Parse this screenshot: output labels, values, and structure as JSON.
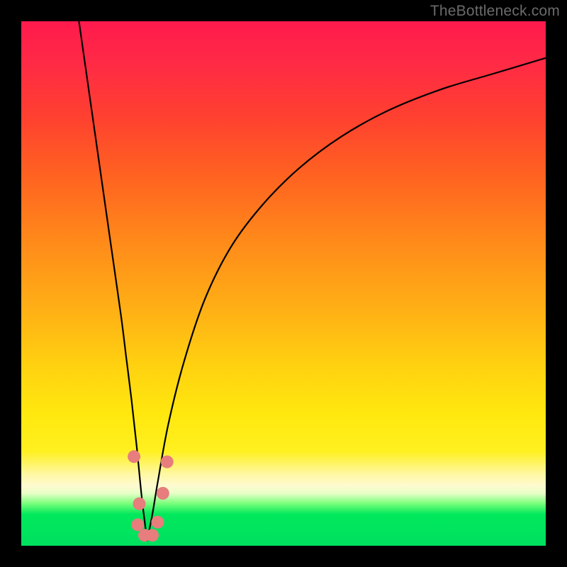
{
  "watermark": "TheBottleneck.com",
  "colors": {
    "frame": "#000000",
    "gradient_top": "#ff1a4d",
    "gradient_mid": "#ffd210",
    "gradient_bottom": "#00e060",
    "curve": "#000000",
    "marker": "#e77d7d"
  },
  "chart_data": {
    "type": "line",
    "title": "",
    "xlabel": "",
    "ylabel": "",
    "xlim": [
      0,
      100
    ],
    "ylim": [
      0,
      100
    ],
    "grid": false,
    "legend": false,
    "note": "Axes are unlabeled in the original image; data values are estimated from pixel positions on a 0–100 scale where 0,0 is the lower-left of the colored plot area. The figure is a V-shaped bottleneck curve: a steep falling branch on the left and a slower rising branch on the right, meeting near x≈24, y≈0. Small pink markers highlight the near-bottom segment of the V.",
    "series": [
      {
        "name": "left_branch",
        "x": [
          11,
          13,
          15,
          17,
          19,
          20,
          21,
          22,
          23,
          24
        ],
        "y": [
          100,
          86,
          72,
          58,
          44,
          36,
          28,
          19,
          9,
          1
        ]
      },
      {
        "name": "right_branch",
        "x": [
          24,
          25,
          26,
          28,
          31,
          35,
          40,
          46,
          53,
          61,
          70,
          80,
          90,
          100
        ],
        "y": [
          1,
          6,
          12,
          23,
          35,
          47,
          57,
          65,
          72,
          78,
          83,
          87,
          90,
          93
        ]
      }
    ],
    "markers": [
      {
        "x": 21.5,
        "y": 17
      },
      {
        "x": 22.5,
        "y": 8
      },
      {
        "x": 22.2,
        "y": 4
      },
      {
        "x": 23.5,
        "y": 2
      },
      {
        "x": 25.0,
        "y": 2
      },
      {
        "x": 26.0,
        "y": 4.5
      },
      {
        "x": 27.0,
        "y": 10
      },
      {
        "x": 27.8,
        "y": 16
      }
    ]
  }
}
